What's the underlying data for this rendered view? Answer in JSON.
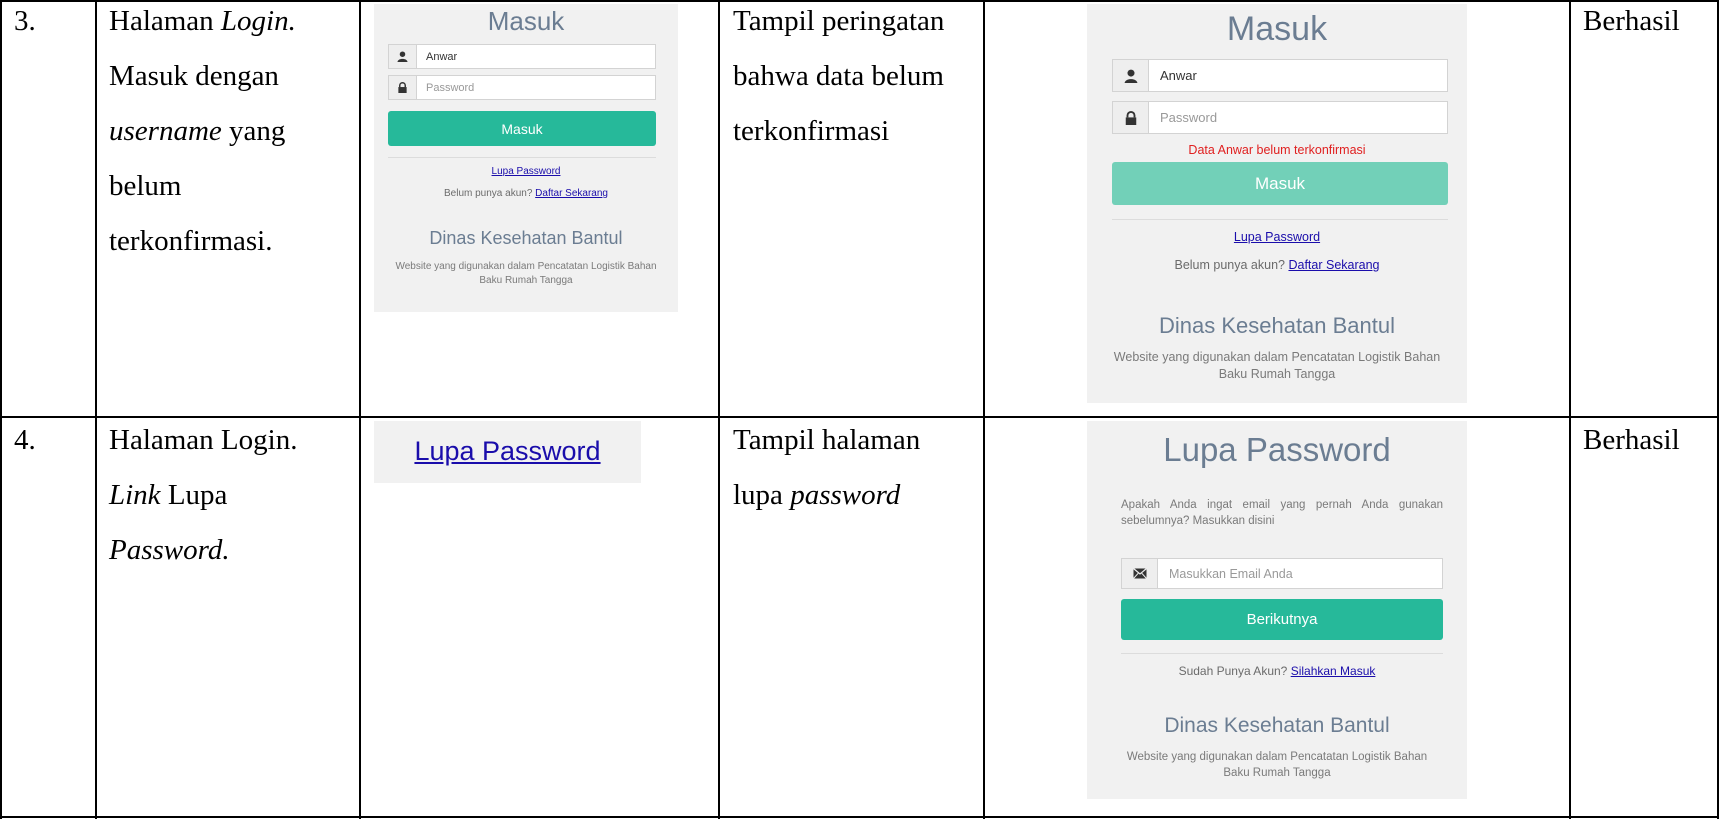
{
  "rows": [
    {
      "number": "3.",
      "scenario": {
        "line1_a": "Halaman ",
        "line1_b": "Login.",
        "line2": "Masuk dengan",
        "line3_a": "username",
        "line3_b": " yang",
        "line4": "belum",
        "line5": "terkonfirmasi."
      },
      "expected": {
        "line1": "Tampil peringatan",
        "line2": "bahwa data belum",
        "line3": "terkonfirmasi"
      },
      "result": "Berhasil",
      "input_shot": {
        "title": "Masuk",
        "username_value": "Anwar",
        "password_placeholder": "Password",
        "login_button": "Masuk",
        "forgot_link": "Lupa Password",
        "no_account_text": "Belum punya akun?",
        "register_link": "Daftar Sekarang",
        "org_name": "Dinas Kesehatan Bantul",
        "description": "Website yang digunakan dalam Pencatatan Logistik Bahan Baku Rumah Tangga"
      },
      "output_shot": {
        "title": "Masuk",
        "username_value": "Anwar",
        "password_placeholder": "Password",
        "error_message": "Data Anwar belum terkonfirmasi",
        "login_button": "Masuk",
        "forgot_link": "Lupa Password",
        "no_account_text": "Belum punya akun?",
        "register_link": "Daftar Sekarang",
        "org_name": "Dinas Kesehatan Bantul",
        "description": "Website yang digunakan dalam Pencatatan Logistik Bahan Baku Rumah Tangga"
      }
    },
    {
      "number": "4.",
      "scenario": {
        "line1": "Halaman Login.",
        "line2_a": "Link",
        "line2_b": " Lupa",
        "line3": "Password."
      },
      "expected": {
        "line1": "Tampil halaman",
        "line2_a": "lupa ",
        "line2_b": "password"
      },
      "result": "Berhasil",
      "input_shot": {
        "link_text": "Lupa Password"
      },
      "output_shot": {
        "title": "Lupa Password",
        "prompt_text": "Apakah Anda ingat email yang pernah Anda gunakan sebelumnya? Masukkan disini",
        "email_placeholder": "Masukkan Email Anda",
        "next_button": "Berikutnya",
        "have_account_text": "Sudah Punya Akun?",
        "login_link": "Silahkan Masuk",
        "org_name": "Dinas Kesehatan Bantul",
        "description": "Website yang digunakan dalam Pencatatan Logistik Bahan Baku Rumah Tangga"
      }
    }
  ],
  "icons": {
    "user": "user-icon",
    "lock": "lock-icon",
    "envelope": "envelope-icon"
  },
  "colors": {
    "button": "#26b99a",
    "button_disabled": "#72d0b8",
    "heading": "#6b7d92",
    "error": "#e02020",
    "link": "#1a0dab"
  }
}
